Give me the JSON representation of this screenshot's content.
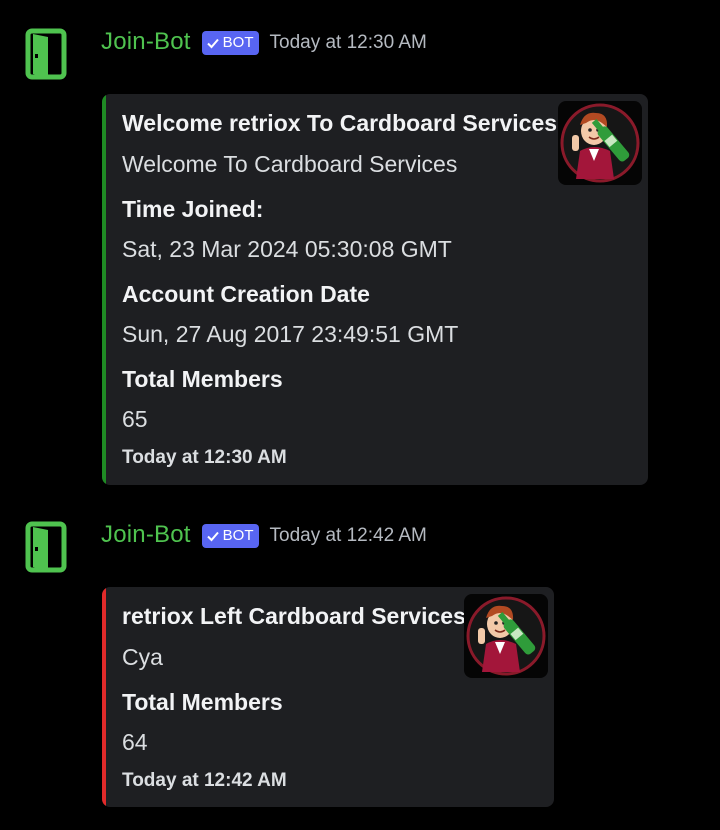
{
  "colors": {
    "background": "#000000",
    "username": "#4fc34f",
    "bot_badge": "#5865f2",
    "embed_bg": "#1e1f22",
    "join_accent": "#1f8b24",
    "leave_accent": "#e12a2a"
  },
  "messages": [
    {
      "avatar_icon": "door-exit-icon",
      "username": "Join-Bot",
      "badge": "BOT",
      "timestamp": "Today at 12:30 AM",
      "embed": {
        "title": "Welcome retriox To Cardboard Services",
        "description": "Welcome To Cardboard Services",
        "thumbnail_icon": "cartoon-mascot-thumbnail",
        "fields": [
          {
            "name": "Time Joined:",
            "value": "Sat, 23 Mar 2024 05:30:08 GMT"
          },
          {
            "name": "Account Creation Date",
            "value": "Sun, 27 Aug 2017 23:49:51 GMT"
          },
          {
            "name": "Total Members",
            "value": "65"
          }
        ],
        "footer": "Today at 12:30 AM"
      }
    },
    {
      "avatar_icon": "door-exit-icon",
      "username": "Join-Bot",
      "badge": "BOT",
      "timestamp": "Today at 12:42 AM",
      "embed": {
        "title": "retriox Left Cardboard Services",
        "description": "Cya",
        "thumbnail_icon": "cartoon-mascot-thumbnail",
        "fields": [
          {
            "name": "Total Members",
            "value": "64"
          }
        ],
        "footer": "Today at 12:42 AM"
      }
    }
  ]
}
